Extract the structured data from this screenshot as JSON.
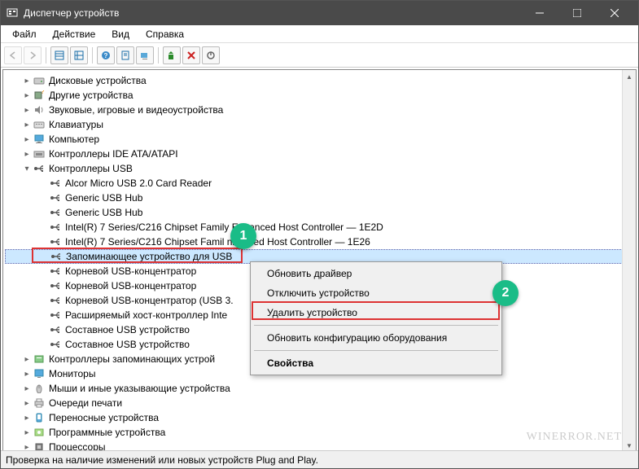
{
  "window": {
    "title": "Диспетчер устройств"
  },
  "menubar": {
    "file": "Файл",
    "action": "Действие",
    "view": "Вид",
    "help": "Справка"
  },
  "tree": {
    "items": [
      {
        "depth": 1,
        "tw": "",
        "icon": "drive",
        "label": "Дисковые устройства"
      },
      {
        "depth": 1,
        "tw": "",
        "icon": "other",
        "label": "Другие устройства"
      },
      {
        "depth": 1,
        "tw": "",
        "icon": "audio",
        "label": "Звуковые, игровые и видеоустройства"
      },
      {
        "depth": 1,
        "tw": "",
        "icon": "keyboard",
        "label": "Клавиатуры"
      },
      {
        "depth": 1,
        "tw": "",
        "icon": "computer",
        "label": "Компьютер"
      },
      {
        "depth": 1,
        "tw": "",
        "icon": "ide",
        "label": "Контроллеры IDE ATA/ATAPI"
      },
      {
        "depth": 1,
        "tw": "v",
        "icon": "usb",
        "label": "Контроллеры USB"
      },
      {
        "depth": 2,
        "tw": "",
        "icon": "usb",
        "label": "Alcor Micro USB 2.0 Card Reader"
      },
      {
        "depth": 2,
        "tw": "",
        "icon": "usb",
        "label": "Generic USB Hub"
      },
      {
        "depth": 2,
        "tw": "",
        "icon": "usb",
        "label": "Generic USB Hub"
      },
      {
        "depth": 2,
        "tw": "",
        "icon": "usb",
        "label": "Intel(R) 7 Series/C216 Chipset Family   Enhanced Host Controller — 1E2D"
      },
      {
        "depth": 2,
        "tw": "",
        "icon": "usb",
        "label": "Intel(R) 7 Series/C216 Chipset Famil   nhanced Host Controller — 1E26"
      },
      {
        "depth": 2,
        "tw": "",
        "icon": "usb",
        "label": "Запоминающее устройство для USB",
        "sel": true
      },
      {
        "depth": 2,
        "tw": "",
        "icon": "usb",
        "label": "Корневой USB-концентратор"
      },
      {
        "depth": 2,
        "tw": "",
        "icon": "usb",
        "label": "Корневой USB-концентратор"
      },
      {
        "depth": 2,
        "tw": "",
        "icon": "usb",
        "label": "Корневой USB-концентратор (USB 3."
      },
      {
        "depth": 2,
        "tw": "",
        "icon": "usb",
        "label": "Расширяемый хост-контроллер Inte"
      },
      {
        "depth": 2,
        "tw": "",
        "icon": "usb",
        "label": "Составное USB устройство"
      },
      {
        "depth": 2,
        "tw": "",
        "icon": "usb",
        "label": "Составное USB устройство"
      },
      {
        "depth": 1,
        "tw": "",
        "icon": "storage",
        "label": "Контроллеры запоминающих устрой"
      },
      {
        "depth": 1,
        "tw": "",
        "icon": "monitor",
        "label": "Мониторы"
      },
      {
        "depth": 1,
        "tw": "",
        "icon": "mouse",
        "label": "Мыши и иные указывающие устройства"
      },
      {
        "depth": 1,
        "tw": "",
        "icon": "printer",
        "label": "Очереди печати"
      },
      {
        "depth": 1,
        "tw": "",
        "icon": "portable",
        "label": "Переносные устройства"
      },
      {
        "depth": 1,
        "tw": "",
        "icon": "software",
        "label": "Программные устройства"
      },
      {
        "depth": 1,
        "tw": "",
        "icon": "cpu",
        "label": "Процессоры"
      }
    ]
  },
  "ctxmenu": {
    "update": "Обновить драйвер",
    "disable": "Отключить устройство",
    "remove": "Удалить устройство",
    "refresh": "Обновить конфигурацию оборудования",
    "props": "Свойства"
  },
  "statusbar": "Проверка на наличие изменений или новых устройств Plug and Play.",
  "watermark": "WINERROR.NET",
  "badges": {
    "one": "1",
    "two": "2"
  }
}
